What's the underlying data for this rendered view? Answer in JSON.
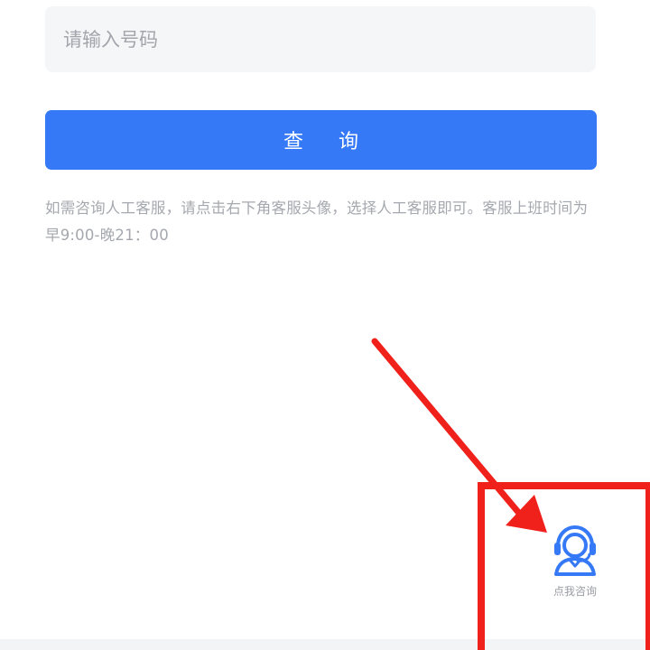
{
  "form": {
    "phone_input": {
      "placeholder": "请输入号码",
      "value": ""
    },
    "query_button_label": "查 询",
    "notice_text": "如需咨询人工客服，请点击右下角客服头像，选择人工客服即可。客服上班时间为早9:00-晚21：00"
  },
  "customer_service": {
    "label": "点我咨询",
    "icon": "headset-agent-icon"
  },
  "annotation": {
    "arrow_color": "#f0201b",
    "box_color": "#f0201b"
  },
  "colors": {
    "accent": "#3579f6",
    "input_bg": "#f5f6f8",
    "muted_text": "#a5a8ae"
  }
}
